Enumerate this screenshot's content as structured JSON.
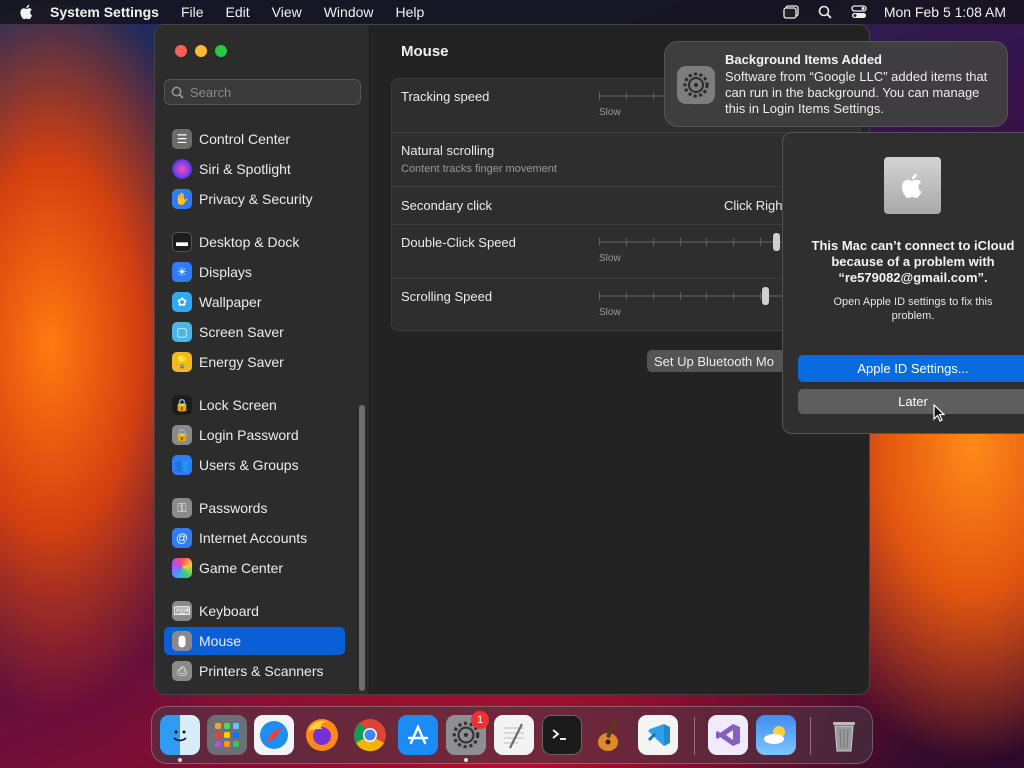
{
  "menubar": {
    "app_name": "System Settings",
    "menus": [
      "File",
      "Edit",
      "View",
      "Window",
      "Help"
    ],
    "clock": "Mon Feb 5  1:08 AM"
  },
  "sidebar": {
    "search_placeholder": "Search",
    "items": [
      {
        "label": "Control Center",
        "icon": "control-center-icon",
        "color": "#6b6b6b"
      },
      {
        "label": "Siri & Spotlight",
        "icon": "siri-icon",
        "color": "#b03cd8"
      },
      {
        "label": "Privacy & Security",
        "icon": "hand-icon",
        "color": "#2f7cf6"
      },
      {
        "label": "Desktop & Dock",
        "icon": "dock-icon",
        "color": "#1c1c1c"
      },
      {
        "label": "Displays",
        "icon": "sun-icon",
        "color": "#2f7cf6"
      },
      {
        "label": "Wallpaper",
        "icon": "flower-icon",
        "color": "#2fa9f0"
      },
      {
        "label": "Screen Saver",
        "icon": "screen-saver-icon",
        "color": "#4ab6e8"
      },
      {
        "label": "Energy Saver",
        "icon": "bulb-icon",
        "color": "#f2b824"
      },
      {
        "label": "Lock Screen",
        "icon": "lock-icon",
        "color": "#1c1c1c"
      },
      {
        "label": "Login Password",
        "icon": "lock-icon",
        "color": "#8a8a8a"
      },
      {
        "label": "Users & Groups",
        "icon": "users-icon",
        "color": "#2f7cf6"
      },
      {
        "label": "Passwords",
        "icon": "key-icon",
        "color": "#8a8a8a"
      },
      {
        "label": "Internet Accounts",
        "icon": "at-icon",
        "color": "#2f7cf6"
      },
      {
        "label": "Game Center",
        "icon": "game-center-icon",
        "color": "#e8e8e8"
      },
      {
        "label": "Keyboard",
        "icon": "keyboard-icon",
        "color": "#8a8a8a"
      },
      {
        "label": "Mouse",
        "icon": "mouse-icon",
        "color": "#8a8a8a"
      },
      {
        "label": "Printers & Scanners",
        "icon": "printer-icon",
        "color": "#8a8a8a"
      }
    ],
    "selected": "Mouse"
  },
  "content": {
    "title": "Mouse",
    "rows": {
      "tracking_speed": {
        "label": "Tracking speed",
        "min_label": "Slow",
        "level": 0.5
      },
      "natural_scrolling": {
        "label": "Natural scrolling",
        "sub": "Content tracks finger movement"
      },
      "secondary_click": {
        "label": "Secondary click",
        "value": "Click Righ"
      },
      "double_click": {
        "label": "Double-Click Speed",
        "min_label": "Slow",
        "level": 0.95
      },
      "scrolling_speed": {
        "label": "Scrolling Speed",
        "min_label": "Slow",
        "level": 0.89
      }
    },
    "bt_button": "Set Up Bluetooth Mo"
  },
  "notification": {
    "title": "Background Items Added",
    "body": "Software from “Google LLC” added items that can run in the background. You can manage this in Login Items Settings."
  },
  "alert": {
    "title": "This Mac can’t connect to iCloud because of a problem with “re579082@gmail.com”.",
    "body": "Open Apple ID settings to fix this problem.",
    "primary": "Apple ID Settings...",
    "secondary": "Later"
  },
  "dock": {
    "apps": [
      "Finder",
      "Launchpad",
      "Safari",
      "Firefox",
      "Chrome",
      "App Store",
      "System Settings",
      "TextEdit",
      "Terminal",
      "GarageBand",
      "VS Code",
      "Visual Studio",
      "Weather",
      "Trash"
    ],
    "settings_badge": "1"
  },
  "colors": {
    "accent": "#0a5fd6",
    "button_blue": "#0a6ae0"
  }
}
